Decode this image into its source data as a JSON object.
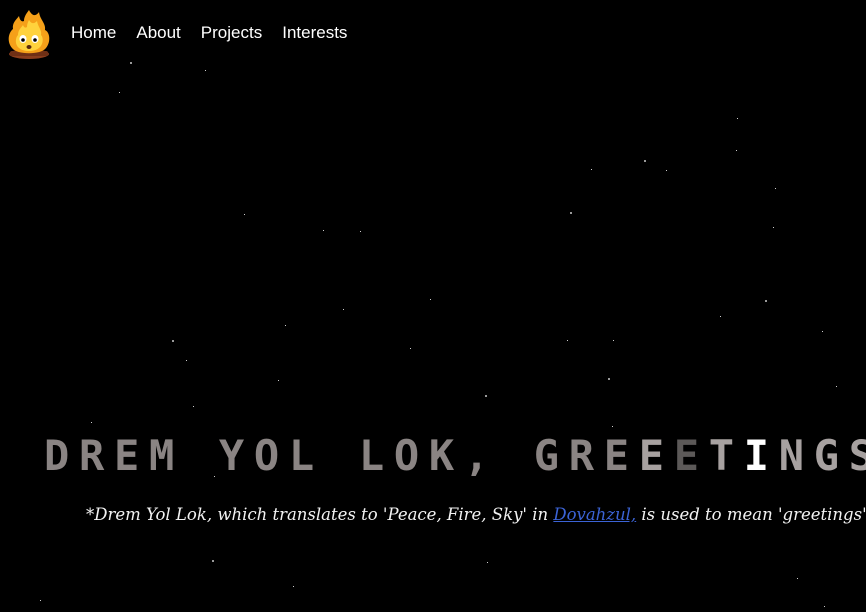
{
  "nav": {
    "logo_icon": "flame-character-icon",
    "items": [
      {
        "label": "Home"
      },
      {
        "label": "About"
      },
      {
        "label": "Projects"
      },
      {
        "label": "Interests"
      }
    ]
  },
  "hero": {
    "title_parts": [
      "DREM YOL LOK, GRE",
      "E",
      "E",
      "T",
      "I",
      "NGS"
    ],
    "tagline_before": "*Drem Yol Lok, which translates to 'Peace, Fire, Sky' in ",
    "tagline_link": "Dovahzul,",
    "tagline_after": " is used to mean 'greetings'"
  },
  "colors": {
    "background": "#000000",
    "text": "#ffffff",
    "title": "#8a8483",
    "link": "#3b63d6"
  }
}
